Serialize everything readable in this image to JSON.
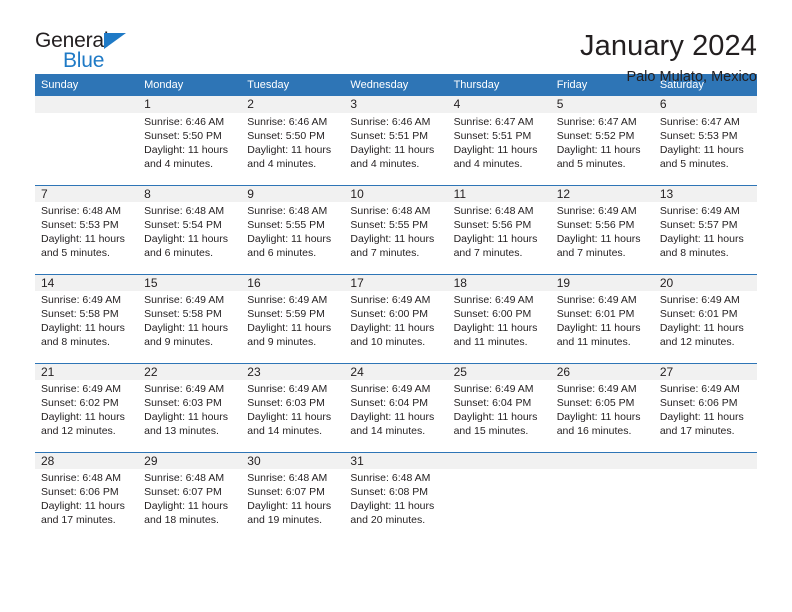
{
  "brand": {
    "name_top": "General",
    "name_bottom": "Blue",
    "triangle_icon": "brand-triangle-icon",
    "color_blue": "#1f7ac6"
  },
  "header": {
    "title": "January 2024",
    "subtitle": "Palo Mulato, Mexico"
  },
  "theme": {
    "header_blue": "#2e75b6",
    "date_band": "#f1f1f1",
    "text": "#231f20"
  },
  "calendar": {
    "weekday_headers": [
      "Sunday",
      "Monday",
      "Tuesday",
      "Wednesday",
      "Thursday",
      "Friday",
      "Saturday"
    ],
    "weeks": [
      [
        {
          "day": "",
          "lines": []
        },
        {
          "day": "1",
          "lines": [
            "Sunrise: 6:46 AM",
            "Sunset: 5:50 PM",
            "Daylight: 11 hours",
            "and 4 minutes."
          ]
        },
        {
          "day": "2",
          "lines": [
            "Sunrise: 6:46 AM",
            "Sunset: 5:50 PM",
            "Daylight: 11 hours",
            "and 4 minutes."
          ]
        },
        {
          "day": "3",
          "lines": [
            "Sunrise: 6:46 AM",
            "Sunset: 5:51 PM",
            "Daylight: 11 hours",
            "and 4 minutes."
          ]
        },
        {
          "day": "4",
          "lines": [
            "Sunrise: 6:47 AM",
            "Sunset: 5:51 PM",
            "Daylight: 11 hours",
            "and 4 minutes."
          ]
        },
        {
          "day": "5",
          "lines": [
            "Sunrise: 6:47 AM",
            "Sunset: 5:52 PM",
            "Daylight: 11 hours",
            "and 5 minutes."
          ]
        },
        {
          "day": "6",
          "lines": [
            "Sunrise: 6:47 AM",
            "Sunset: 5:53 PM",
            "Daylight: 11 hours",
            "and 5 minutes."
          ]
        }
      ],
      [
        {
          "day": "7",
          "lines": [
            "Sunrise: 6:48 AM",
            "Sunset: 5:53 PM",
            "Daylight: 11 hours",
            "and 5 minutes."
          ]
        },
        {
          "day": "8",
          "lines": [
            "Sunrise: 6:48 AM",
            "Sunset: 5:54 PM",
            "Daylight: 11 hours",
            "and 6 minutes."
          ]
        },
        {
          "day": "9",
          "lines": [
            "Sunrise: 6:48 AM",
            "Sunset: 5:55 PM",
            "Daylight: 11 hours",
            "and 6 minutes."
          ]
        },
        {
          "day": "10",
          "lines": [
            "Sunrise: 6:48 AM",
            "Sunset: 5:55 PM",
            "Daylight: 11 hours",
            "and 7 minutes."
          ]
        },
        {
          "day": "11",
          "lines": [
            "Sunrise: 6:48 AM",
            "Sunset: 5:56 PM",
            "Daylight: 11 hours",
            "and 7 minutes."
          ]
        },
        {
          "day": "12",
          "lines": [
            "Sunrise: 6:49 AM",
            "Sunset: 5:56 PM",
            "Daylight: 11 hours",
            "and 7 minutes."
          ]
        },
        {
          "day": "13",
          "lines": [
            "Sunrise: 6:49 AM",
            "Sunset: 5:57 PM",
            "Daylight: 11 hours",
            "and 8 minutes."
          ]
        }
      ],
      [
        {
          "day": "14",
          "lines": [
            "Sunrise: 6:49 AM",
            "Sunset: 5:58 PM",
            "Daylight: 11 hours",
            "and 8 minutes."
          ]
        },
        {
          "day": "15",
          "lines": [
            "Sunrise: 6:49 AM",
            "Sunset: 5:58 PM",
            "Daylight: 11 hours",
            "and 9 minutes."
          ]
        },
        {
          "day": "16",
          "lines": [
            "Sunrise: 6:49 AM",
            "Sunset: 5:59 PM",
            "Daylight: 11 hours",
            "and 9 minutes."
          ]
        },
        {
          "day": "17",
          "lines": [
            "Sunrise: 6:49 AM",
            "Sunset: 6:00 PM",
            "Daylight: 11 hours",
            "and 10 minutes."
          ]
        },
        {
          "day": "18",
          "lines": [
            "Sunrise: 6:49 AM",
            "Sunset: 6:00 PM",
            "Daylight: 11 hours",
            "and 11 minutes."
          ]
        },
        {
          "day": "19",
          "lines": [
            "Sunrise: 6:49 AM",
            "Sunset: 6:01 PM",
            "Daylight: 11 hours",
            "and 11 minutes."
          ]
        },
        {
          "day": "20",
          "lines": [
            "Sunrise: 6:49 AM",
            "Sunset: 6:01 PM",
            "Daylight: 11 hours",
            "and 12 minutes."
          ]
        }
      ],
      [
        {
          "day": "21",
          "lines": [
            "Sunrise: 6:49 AM",
            "Sunset: 6:02 PM",
            "Daylight: 11 hours",
            "and 12 minutes."
          ]
        },
        {
          "day": "22",
          "lines": [
            "Sunrise: 6:49 AM",
            "Sunset: 6:03 PM",
            "Daylight: 11 hours",
            "and 13 minutes."
          ]
        },
        {
          "day": "23",
          "lines": [
            "Sunrise: 6:49 AM",
            "Sunset: 6:03 PM",
            "Daylight: 11 hours",
            "and 14 minutes."
          ]
        },
        {
          "day": "24",
          "lines": [
            "Sunrise: 6:49 AM",
            "Sunset: 6:04 PM",
            "Daylight: 11 hours",
            "and 14 minutes."
          ]
        },
        {
          "day": "25",
          "lines": [
            "Sunrise: 6:49 AM",
            "Sunset: 6:04 PM",
            "Daylight: 11 hours",
            "and 15 minutes."
          ]
        },
        {
          "day": "26",
          "lines": [
            "Sunrise: 6:49 AM",
            "Sunset: 6:05 PM",
            "Daylight: 11 hours",
            "and 16 minutes."
          ]
        },
        {
          "day": "27",
          "lines": [
            "Sunrise: 6:49 AM",
            "Sunset: 6:06 PM",
            "Daylight: 11 hours",
            "and 17 minutes."
          ]
        }
      ],
      [
        {
          "day": "28",
          "lines": [
            "Sunrise: 6:48 AM",
            "Sunset: 6:06 PM",
            "Daylight: 11 hours",
            "and 17 minutes."
          ]
        },
        {
          "day": "29",
          "lines": [
            "Sunrise: 6:48 AM",
            "Sunset: 6:07 PM",
            "Daylight: 11 hours",
            "and 18 minutes."
          ]
        },
        {
          "day": "30",
          "lines": [
            "Sunrise: 6:48 AM",
            "Sunset: 6:07 PM",
            "Daylight: 11 hours",
            "and 19 minutes."
          ]
        },
        {
          "day": "31",
          "lines": [
            "Sunrise: 6:48 AM",
            "Sunset: 6:08 PM",
            "Daylight: 11 hours",
            "and 20 minutes."
          ]
        },
        {
          "day": "",
          "lines": []
        },
        {
          "day": "",
          "lines": []
        },
        {
          "day": "",
          "lines": []
        }
      ]
    ]
  }
}
